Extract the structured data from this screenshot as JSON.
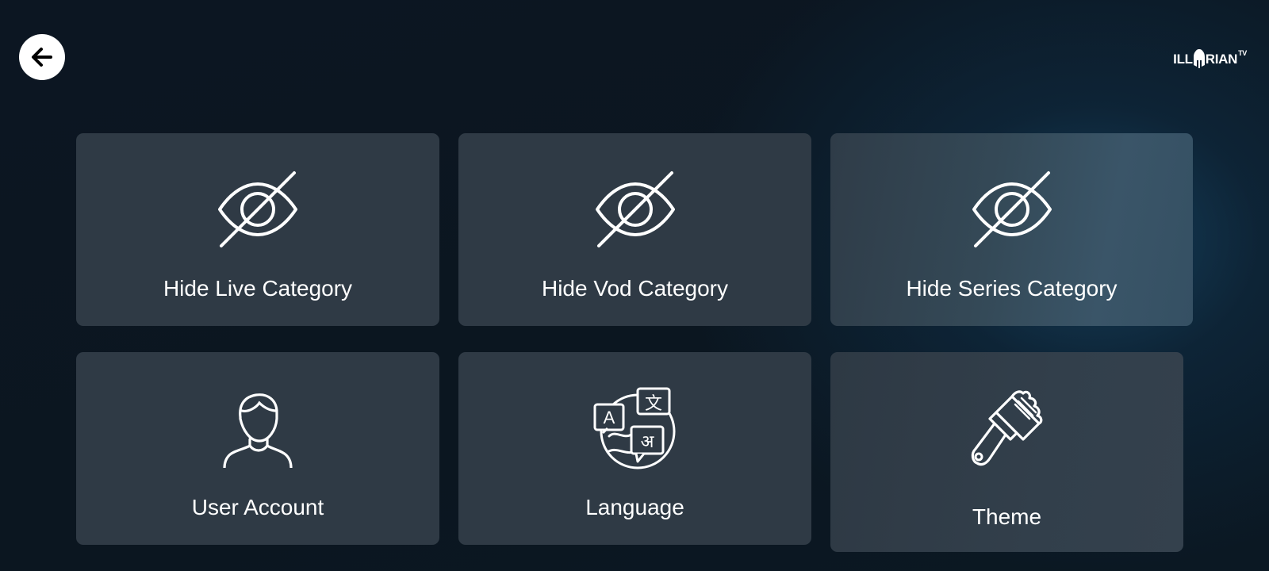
{
  "header": {
    "back_icon": "arrow-left-icon",
    "logo": "ILLYRIAN TV"
  },
  "tiles": [
    {
      "label": "Hide Live Category",
      "icon": "eye-slash-icon"
    },
    {
      "label": "Hide Vod Category",
      "icon": "eye-slash-icon"
    },
    {
      "label": "Hide Series Category",
      "icon": "eye-slash-icon"
    },
    {
      "label": "User Account",
      "icon": "user-icon"
    },
    {
      "label": "Language",
      "icon": "language-icon"
    },
    {
      "label": "Theme",
      "icon": "paint-brush-icon"
    }
  ],
  "colors": {
    "background": "#0c1622",
    "tile": "#2f3a45",
    "accent_glow": "#1a4e70",
    "text": "#ffffff"
  }
}
